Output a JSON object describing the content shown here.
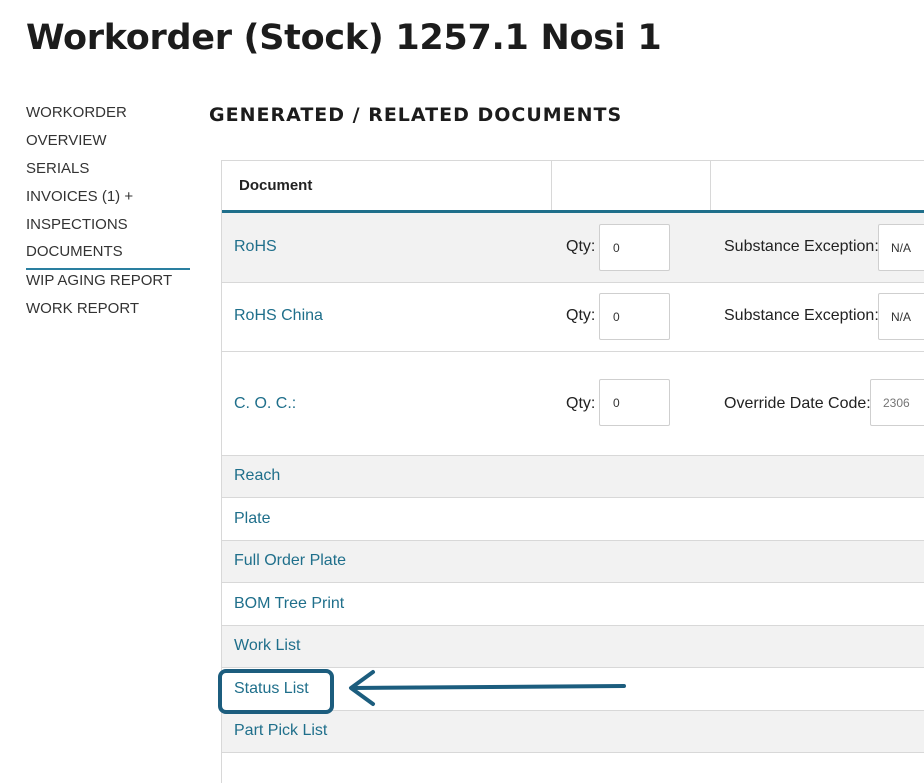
{
  "page": {
    "title": "Workorder (Stock) 1257.1 Nosi 1"
  },
  "sidebar": {
    "items": [
      {
        "label": "WORKORDER"
      },
      {
        "label": "OVERVIEW"
      },
      {
        "label": "SERIALS"
      },
      {
        "label": "INVOICES (1) +"
      },
      {
        "label": "INSPECTIONS"
      },
      {
        "label": "DOCUMENTS",
        "active": true
      },
      {
        "label": "WIP AGING REPORT"
      },
      {
        "label": "WORK REPORT"
      }
    ]
  },
  "section": {
    "title": "GENERATED / RELATED DOCUMENTS"
  },
  "table": {
    "header": {
      "document": "Document"
    },
    "rows": [
      {
        "name": "RoHS",
        "qty_label": "Qty:",
        "qty": "0",
        "field_label": "Substance Exception:",
        "field_value": "N/A"
      },
      {
        "name": "RoHS China",
        "qty_label": "Qty:",
        "qty": "0",
        "field_label": "Substance Exception:",
        "field_value": "N/A"
      },
      {
        "name": "C. O. C.:",
        "qty_label": "Qty:",
        "qty": "0",
        "field_label": "Override Date Code:",
        "field_placeholder": "2306"
      }
    ],
    "links": [
      "Reach",
      "Plate",
      "Full Order Plate",
      "BOM Tree Print",
      "Work List",
      "Status List",
      "Part Pick List"
    ]
  },
  "annotation": {
    "highlight_color": "#1c5d7e",
    "target": "Status List"
  },
  "colors": {
    "accent": "#1f6f8b",
    "link": "#1f6f8b"
  }
}
